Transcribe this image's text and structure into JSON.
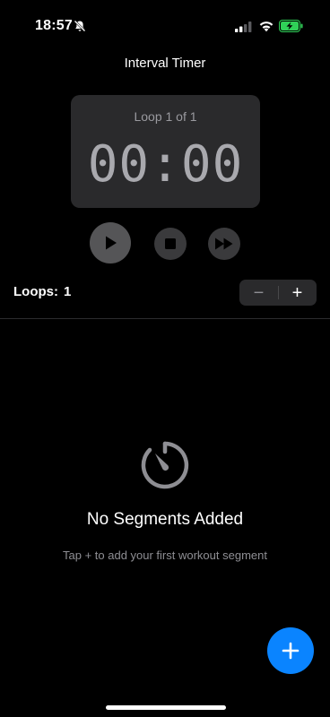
{
  "status_bar": {
    "time": "18:57"
  },
  "header": {
    "title": "Interval Timer"
  },
  "timer": {
    "loop_label": "Loop 1 of 1",
    "display": "00:00"
  },
  "controls": {
    "play_icon": "play-icon",
    "stop_icon": "stop-icon",
    "skip_icon": "fast-forward-icon"
  },
  "loops": {
    "label": "Loops:",
    "value": "1",
    "decrement": "−",
    "increment": "+"
  },
  "empty_state": {
    "icon": "timer-icon",
    "title": "No Segments Added",
    "subtitle": "Tap + to add your first workout segment"
  },
  "fab": {
    "label": "+"
  },
  "colors": {
    "background": "#000000",
    "card": "#2a2a2c",
    "accent": "#0a84ff",
    "battery": "#30d158",
    "muted_text": "#8e8e93"
  }
}
